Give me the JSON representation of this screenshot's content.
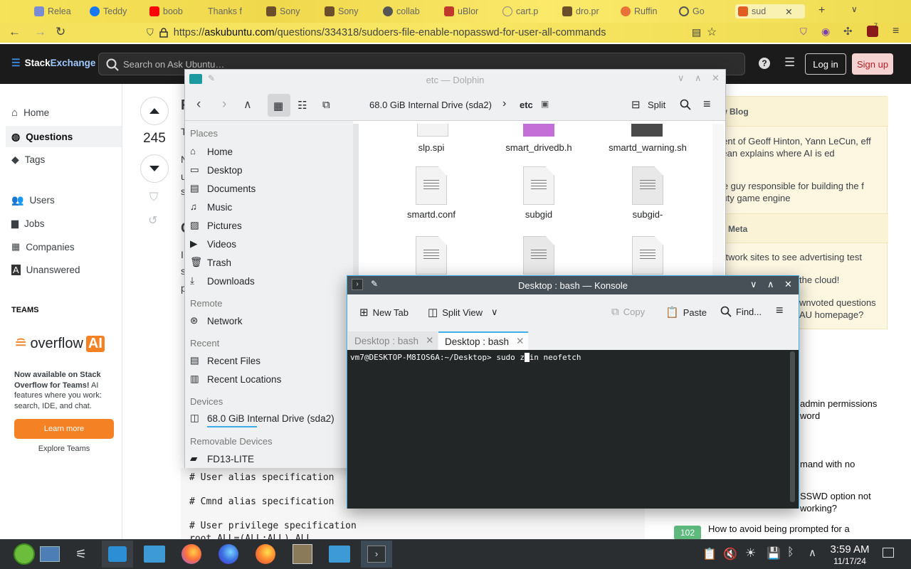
{
  "browser": {
    "tabs": [
      {
        "label": "Relea",
        "color": "#7a8bd6"
      },
      {
        "label": "Teddy",
        "color": "#1877f2"
      },
      {
        "label": "boob",
        "color": "#ff0000"
      },
      {
        "label": "Thanks f",
        "color": "#777777"
      },
      {
        "label": "Sony",
        "color": "#6b4f2a"
      },
      {
        "label": "Sony",
        "color": "#6b4f2a"
      },
      {
        "label": "collab",
        "color": "#555555"
      },
      {
        "label": "uBlor",
        "color": "#c0392b"
      },
      {
        "label": "cart.p",
        "color": "#888888"
      },
      {
        "label": "dro.pr",
        "color": "#6b4f2a"
      },
      {
        "label": "Ruffin",
        "color": "#e8733a"
      },
      {
        "label": "Go",
        "color": "#555555"
      },
      {
        "label": "sud",
        "color": "#e25d24"
      }
    ],
    "url_host": "askubuntu.com",
    "url_prefix": "https://",
    "url_path": "/questions/334318/sudoers-file-enable-nopasswd-for-user-all-commands",
    "ublock_badge": "7"
  },
  "se": {
    "logo_a": "Stack",
    "logo_b": "Exchange",
    "search_placeholder": "Search on Ask Ubuntu…",
    "login": "Log in",
    "signup": "Sign up"
  },
  "nav": {
    "home": "Home",
    "questions": "Questions",
    "tags": "Tags",
    "users": "Users",
    "jobs": "Jobs",
    "companies": "Companies",
    "unanswered": "Unanswered",
    "teams_label": "TEAMS",
    "ovai_a": "overflow",
    "ovai_b": "AI",
    "ovai_bold": "Now available on Stack Overflow for Teams!",
    "ovai_rest": " AI features where you work: search, IDE, and chat.",
    "learn_more": "Learn more",
    "explore": "Explore Teams"
  },
  "question": {
    "votes": "245",
    "frag_r": "R",
    "frag_t": "T",
    "frag_n": "N",
    "frag_u": "u",
    "frag_s": "s",
    "frag_o": "C",
    "frag_i": "I",
    "frag_s2": "s",
    "frag_p": "p",
    "code": [
      "# User alias specification",
      "# Cmnd alias specification",
      "# User privilege specification",
      "root    ALL=(ALL:ALL) ALL"
    ]
  },
  "sidebar": {
    "blog_head": "ow Blog",
    "blog1": "ident of Geoff Hinton, Yann LeCun, eff Dean explains where AI is ed",
    "blog2": "the guy responsible for building the f Duty game engine",
    "meta_head": "on Meta",
    "meta1": "network sites to see advertising test",
    "meta2": "the cloud!",
    "meta3": "wnvoted questions AU homepage?",
    "rel1": "admin permissions word",
    "rel2": "mand with no",
    "rel3": "SSWD option not working?",
    "rel4_badge": "102",
    "rel4": "How to avoid being prompted for a"
  },
  "dolphin": {
    "title": "etc — Dolphin",
    "crumb_drive": "68.0 GiB Internal Drive (sda2)",
    "crumb_etc": "etc",
    "split": "Split",
    "places_head": "Places",
    "places": [
      "Home",
      "Desktop",
      "Documents",
      "Music",
      "Pictures",
      "Videos",
      "Trash",
      "Downloads"
    ],
    "remote_head": "Remote",
    "remote": [
      "Network"
    ],
    "recent_head": "Recent",
    "recent": [
      "Recent Files",
      "Recent Locations"
    ],
    "devices_head": "Devices",
    "devices": [
      "68.0 GiB Internal Drive (sda2)"
    ],
    "removable_head": "Removable Devices",
    "removable": [
      "FD13-LITE"
    ],
    "files": [
      "slp.spi",
      "smart_drivedb.h",
      "smartd_warning.sh",
      "smartd.conf",
      "subgid",
      "subgid-"
    ]
  },
  "konsole": {
    "title": "Desktop : bash — Konsole",
    "new_tab": "New Tab",
    "split_view": "Split View",
    "copy": "Copy",
    "paste": "Paste",
    "find": "Find...",
    "tab1": "Desktop : bash",
    "tab2": "Desktop : bash",
    "prompt": "vm7@DESKTOP-M8IOS6A:~/Desktop> ",
    "cmd_a": "sudo z",
    "cmd_b": "in neofetch"
  },
  "taskbar": {
    "time": "3:59 AM",
    "date": "11/17/24"
  },
  "colors": {
    "so_orange": "#f48225",
    "kde_blue": "#3daee9",
    "signup_red": "#b21f24"
  }
}
